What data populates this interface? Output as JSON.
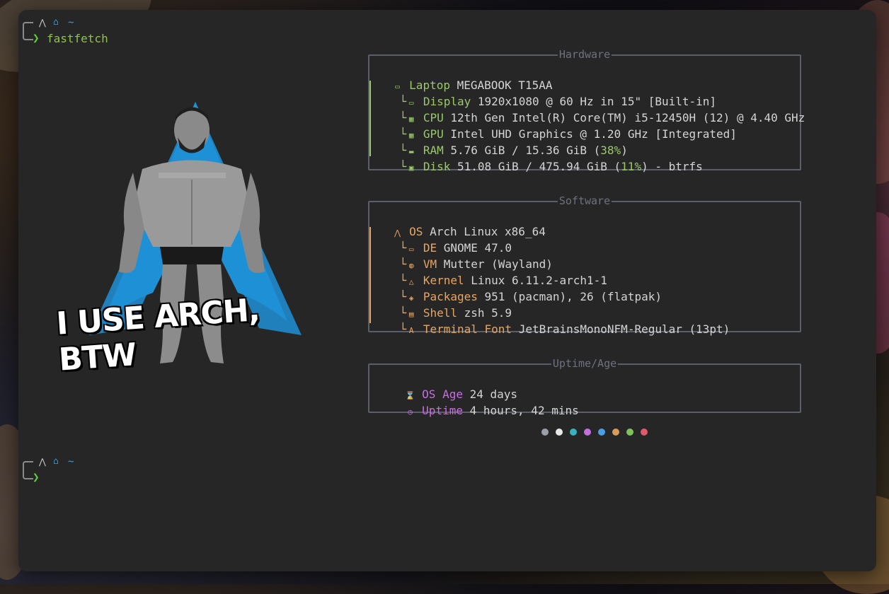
{
  "prompt": {
    "path_symbol": "~",
    "command": "fastfetch",
    "chevron": "❯"
  },
  "logo": {
    "caption": "I USE ARCH, BTW"
  },
  "hardware": {
    "title": "Hardware",
    "host": {
      "label": "Laptop",
      "value": "MEGABOOK T15AA"
    },
    "items": [
      {
        "icon": "monitor-icon",
        "label": "Display",
        "value": "1920x1080 @ 60 Hz in 15\" [Built-in]"
      },
      {
        "icon": "cpu-icon",
        "label": "CPU",
        "value": "12th Gen Intel(R) Core(TM) i5-12450H (12) @ 4.40 GHz"
      },
      {
        "icon": "gpu-icon",
        "label": "GPU",
        "value": "Intel UHD Graphics @ 1.20 GHz [Integrated]"
      },
      {
        "icon": "memory-icon",
        "label": "RAM",
        "value_pre": "5.76 GiB / 15.36 GiB (",
        "pct": "38%",
        "value_post": ")"
      },
      {
        "icon": "disk-icon",
        "label": "Disk",
        "value_pre": "51.08 GiB / 475.94 GiB (",
        "pct": "11%",
        "value_post": ") - btrfs"
      }
    ]
  },
  "software": {
    "title": "Software",
    "os": {
      "label": "OS",
      "value": "Arch Linux x86_64"
    },
    "items": [
      {
        "icon": "desktop-icon",
        "label": "DE",
        "value": "GNOME 47.0"
      },
      {
        "icon": "window-manager-icon",
        "label": "VM",
        "value": "Mutter (Wayland)"
      },
      {
        "icon": "linux-icon",
        "label": "Kernel",
        "value": "Linux 6.11.2-arch1-1"
      },
      {
        "icon": "package-icon",
        "label": "Packages",
        "value": "951 (pacman), 26 (flatpak)"
      },
      {
        "icon": "shell-icon",
        "label": "Shell",
        "value": "zsh 5.9"
      },
      {
        "icon": "font-icon",
        "label": "Terminal Font",
        "value": "JetBrainsMonoNFM-Regular (13pt)"
      }
    ]
  },
  "uptime": {
    "title": "Uptime/Age",
    "os_age": {
      "label": "OS Age",
      "value": "24 days"
    },
    "uptime": {
      "label": "Uptime",
      "value": "4 hours, 42 mins"
    }
  },
  "palette": [
    "#9aa0aa",
    "#e8e8e8",
    "#38b2c0",
    "#c56ee0",
    "#4a9ee8",
    "#d99a5c",
    "#7cc45a",
    "#e05a6a"
  ],
  "colors": {
    "hardware": "#9ac86a",
    "software": "#e9a560",
    "uptime": "#c56ee0",
    "accent_blue": "#1e90d6"
  }
}
